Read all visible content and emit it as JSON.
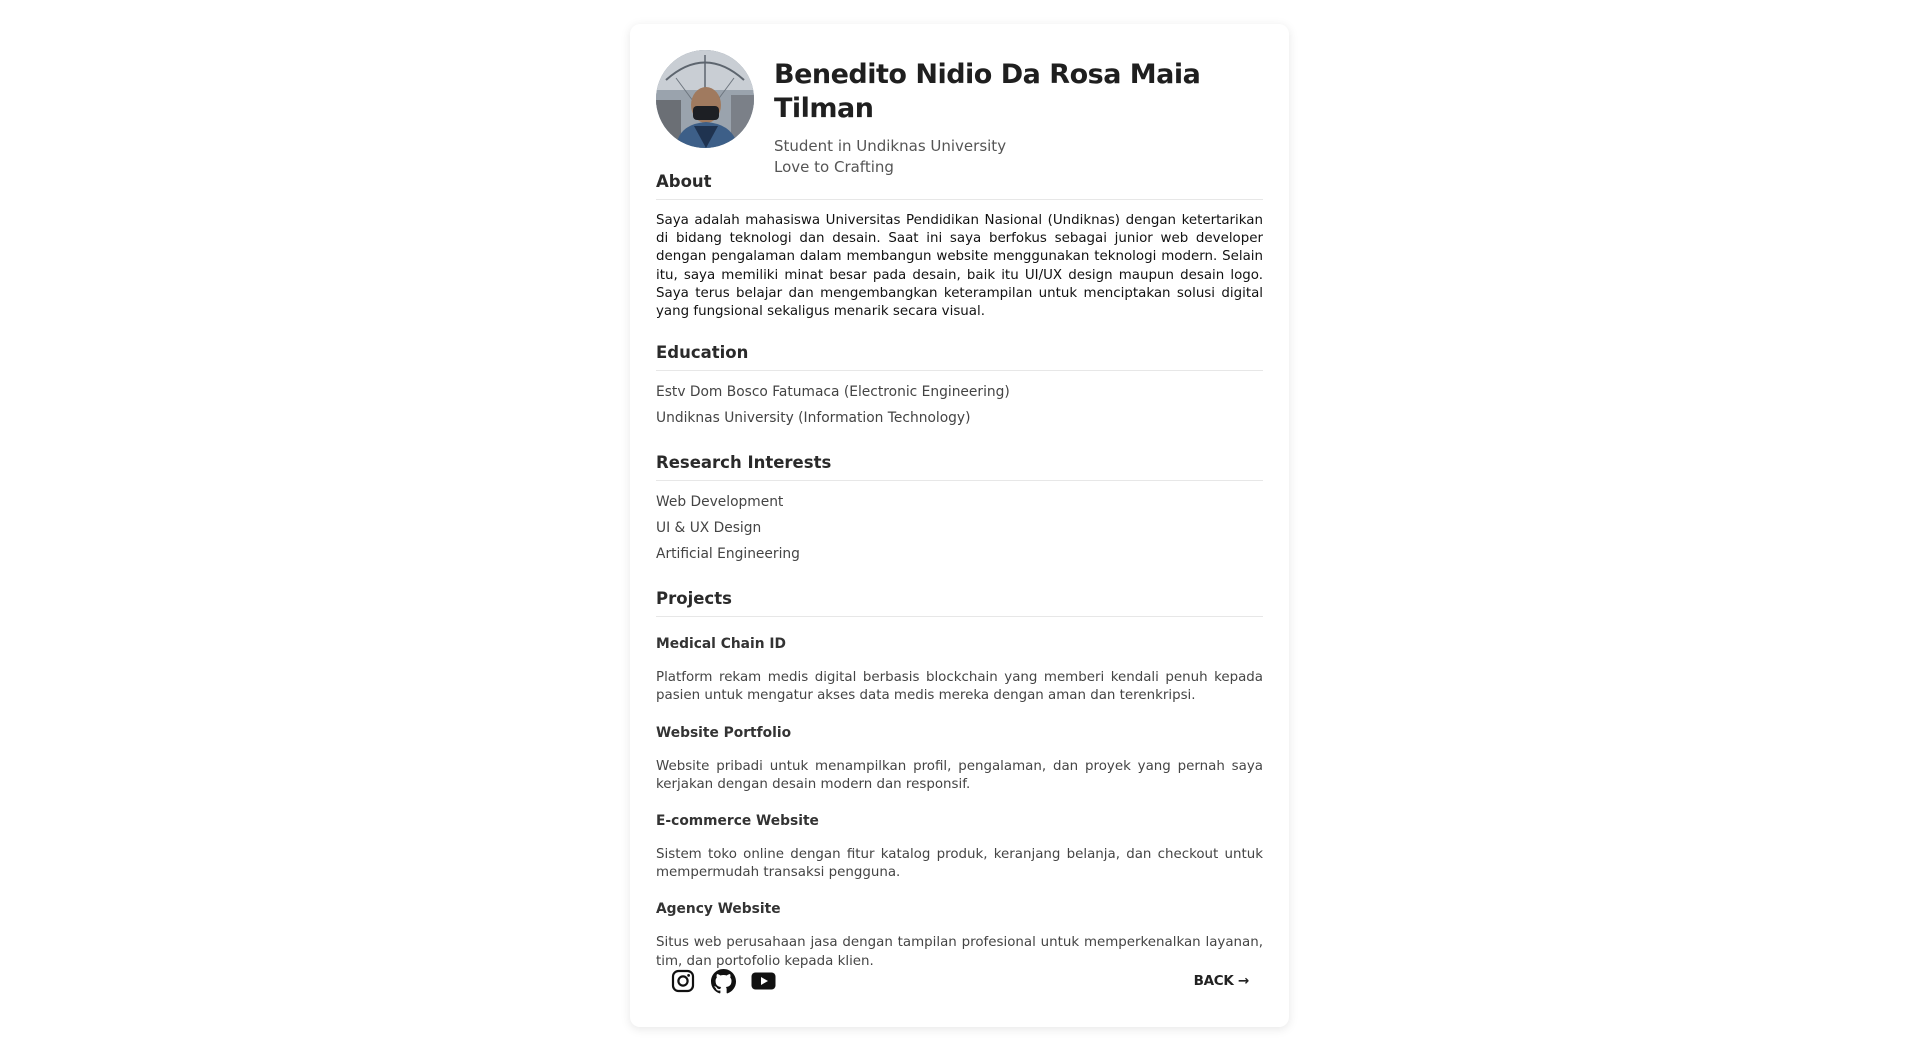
{
  "profile": {
    "name": "Benedito Nidio Da Rosa Maia Tilman",
    "tagline_1": "Student in Undiknas University",
    "tagline_2": "Love to Crafting"
  },
  "about": {
    "title": "About",
    "text": "Saya adalah mahasiswa Universitas Pendidikan Nasional (Undiknas) dengan ketertarikan di bidang teknologi dan desain. Saat ini saya berfokus sebagai junior web developer dengan pengalaman dalam membangun website menggunakan teknologi modern. Selain itu, saya memiliki minat besar pada desain, baik itu UI/UX design maupun desain logo. Saya terus belajar dan mengembangkan keterampilan untuk menciptakan solusi digital yang fungsional sekaligus menarik secara visual."
  },
  "education": {
    "title": "Education",
    "items": [
      "Estv Dom Bosco Fatumaca (Electronic Engineering)",
      "Undiknas University (Information Technology)"
    ]
  },
  "research": {
    "title": "Research Interests",
    "items": [
      "Web Development",
      "UI & UX Design",
      "Artificial Engineering"
    ]
  },
  "projects": {
    "title": "Projects",
    "items": [
      {
        "name": "Medical Chain ID",
        "description": "Platform rekam medis digital berbasis blockchain yang memberi kendali penuh kepada pasien untuk mengatur akses data medis mereka dengan aman dan terenkripsi."
      },
      {
        "name": "Website Portfolio",
        "description": "Website pribadi untuk menampilkan profil, pengalaman, dan proyek yang pernah saya kerjakan dengan desain modern dan responsif."
      },
      {
        "name": "E-commerce Website",
        "description": "Sistem toko online dengan fitur katalog produk, keranjang belanja, dan checkout untuk mempermudah transaksi pengguna."
      },
      {
        "name": "Agency Website",
        "description": "Situs web perusahaan jasa dengan tampilan profesional untuk memperkenalkan layanan, tim, dan portofolio kepada klien."
      }
    ]
  },
  "footer": {
    "socials": [
      "instagram-icon",
      "github-icon",
      "youtube-icon"
    ],
    "back_label": "BACK →"
  }
}
